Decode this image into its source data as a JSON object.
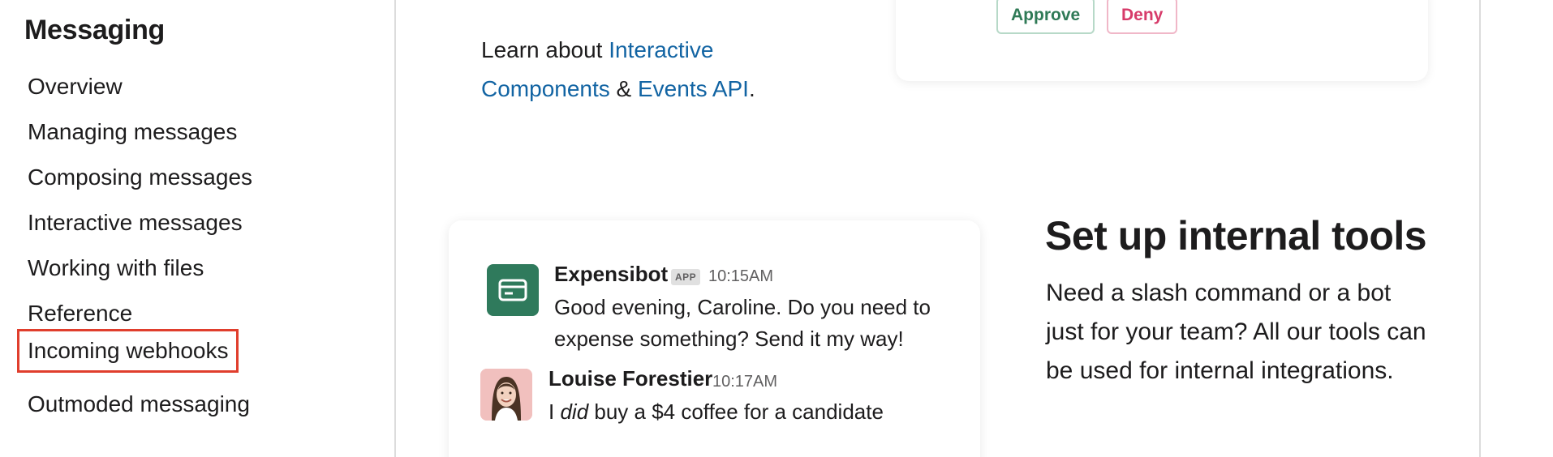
{
  "sidebar": {
    "title": "Messaging",
    "items": [
      {
        "label": "Overview"
      },
      {
        "label": "Managing messages"
      },
      {
        "label": "Composing messages"
      },
      {
        "label": "Interactive messages"
      },
      {
        "label": "Working with files"
      },
      {
        "label": "Reference"
      },
      {
        "label": "Incoming webhooks"
      },
      {
        "label": "Outmoded messaging"
      }
    ],
    "highlighted_item": "Incoming webhooks",
    "highlight_color": "#e03e2d"
  },
  "learn": {
    "prefix": "Learn about ",
    "link1": "Interactive Components",
    "link1_part1": "Interactive",
    "link1_part2": "Components",
    "middle": " & ",
    "link2": "Events API",
    "suffix": "."
  },
  "approval_card": {
    "approve_label": "Approve",
    "deny_label": "Deny"
  },
  "message_card": {
    "messages": [
      {
        "sender": "Expensibot",
        "badge": "APP",
        "time": "10:15AM",
        "text_line1": "Good evening, Caroline. Do you need to",
        "text_line2": "expense something? Send it my way!",
        "avatar_icon": "credit-card-icon"
      },
      {
        "sender": "Louise Forestier",
        "time": "10:17AM",
        "text_pre": "I ",
        "text_em": "did",
        "text_post": " buy a $4 coffee for a candidate"
      }
    ]
  },
  "feature": {
    "title": "Set up internal tools",
    "description": "Need a slash command or a bot just for your team? All our tools can be used for internal integrations."
  },
  "colors": {
    "link": "#1264a3",
    "bot_avatar": "#2f7a5c",
    "approve": "#2f7a56",
    "deny": "#d73b6a"
  }
}
